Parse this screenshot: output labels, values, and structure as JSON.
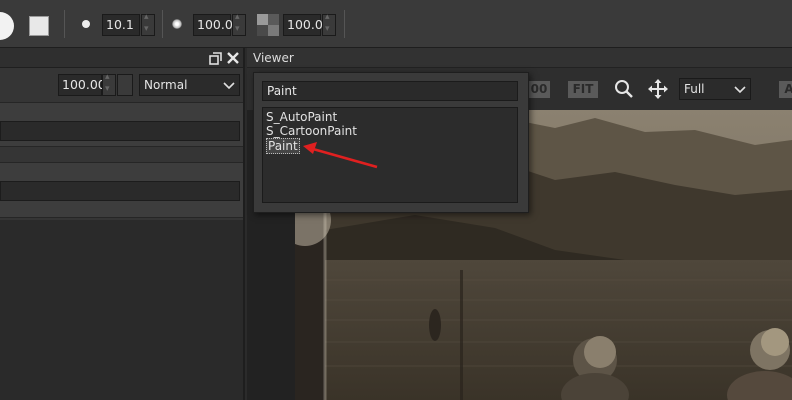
{
  "toolbar": {
    "brush_size": "10.1",
    "opacity": "100.0",
    "transparency": "100.0",
    "icons": [
      "brush-circle-icon",
      "color-swatch-icon",
      "hard-brush-icon",
      "soft-brush-icon",
      "transparency-icon"
    ]
  },
  "left_panel": {
    "opacity_value": "100.00",
    "blend_mode": "Normal",
    "icons": [
      "restore-window-icon",
      "close-icon"
    ]
  },
  "viewer": {
    "title": "Viewer",
    "partial_zoom_label": "00",
    "fit_label": "FIT",
    "resolution": "Full",
    "partial_right_label": "A",
    "icons": [
      "search-icon",
      "move-icon",
      "chevron-down-icon"
    ]
  },
  "search_popup": {
    "query": "Paint",
    "results": [
      "S_AutoPaint",
      "S_CartoonPaint",
      "Paint"
    ],
    "selected_result": "Paint"
  },
  "colors": {
    "annotation_arrow": "#e02020",
    "panel_bg": "#353535",
    "toolbar_bg": "#3a3a3a"
  }
}
